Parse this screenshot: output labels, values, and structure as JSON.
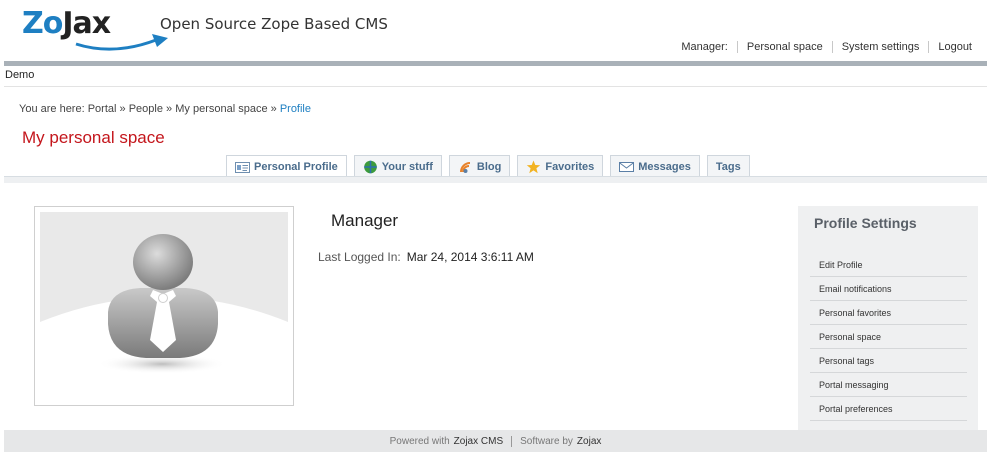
{
  "header": {
    "logo_zo": "Zo",
    "logo_jax": "Jax",
    "site_title": "Open Source Zope Based CMS",
    "nav": {
      "user_label": "Manager:",
      "personal_space": "Personal space",
      "system_settings": "System settings",
      "logout": "Logout"
    },
    "brand_color": "#1e7fc2"
  },
  "subheader": {
    "demo": "Demo"
  },
  "breadcrumb": {
    "prefix": "You are here:",
    "items": [
      "Portal",
      "People",
      "My personal space"
    ],
    "separator": "»",
    "current": "Profile"
  },
  "page": {
    "title": "My personal space",
    "title_color": "#c4161c"
  },
  "tabs": [
    {
      "label": "Personal Profile",
      "icon": "profile-card-icon",
      "active": true
    },
    {
      "label": "Your stuff",
      "icon": "globe-icon",
      "active": false
    },
    {
      "label": "Blog",
      "icon": "rss-icon",
      "active": false
    },
    {
      "label": "Favorites",
      "icon": "star-icon",
      "active": false
    },
    {
      "label": "Messages",
      "icon": "envelope-icon",
      "active": false
    },
    {
      "label": "Tags",
      "icon": "",
      "active": false
    }
  ],
  "profile": {
    "name": "Manager",
    "last_logged_label": "Last Logged In:",
    "last_logged_value": "Mar 24, 2014 3:6:11 AM",
    "avatar_icon": "default-user-avatar-icon"
  },
  "sidepanel": {
    "title": "Profile Settings",
    "items": [
      "Edit Profile",
      "Email notifications",
      "Personal favorites",
      "Personal space",
      "Personal tags",
      "Portal messaging",
      "Portal preferences"
    ]
  },
  "footer": {
    "powered_label": "Powered with",
    "powered_brand": "Zojax CMS",
    "software_label": "Software by",
    "software_brand": "Zojax"
  }
}
